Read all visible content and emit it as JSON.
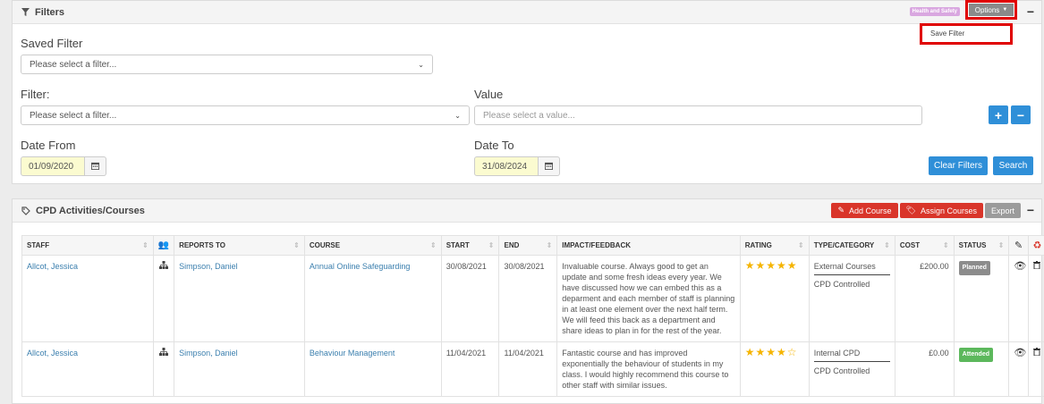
{
  "filters": {
    "title": "Filters",
    "tag": "Health and Safety",
    "options_label": "Options",
    "dropdown": {
      "save_filter": "Save Filter"
    },
    "saved_filter": {
      "label": "Saved Filter",
      "value": "Please select a filter..."
    },
    "filter": {
      "label": "Filter:",
      "value": "Please select a filter..."
    },
    "value": {
      "label": "Value",
      "placeholder": "Please select a value..."
    },
    "date_from": {
      "label": "Date From",
      "value": "01/09/2020"
    },
    "date_to": {
      "label": "Date To",
      "value": "31/08/2024"
    },
    "add_label": "+",
    "remove_label": "−",
    "clear_label": "Clear Filters",
    "search_label": "Search"
  },
  "cpd": {
    "title": "CPD Activities/Courses",
    "add_course": "Add Course",
    "assign_courses": "Assign Courses",
    "export": "Export",
    "columns": {
      "staff": "STAFF",
      "reports_to": "REPORTS TO",
      "course": "COURSE",
      "start": "START",
      "end": "END",
      "impact": "IMPACT/FEEDBACK",
      "rating": "RATING",
      "type": "TYPE/CATEGORY",
      "cost": "COST",
      "status": "STATUS"
    },
    "rows": [
      {
        "staff": "Allcot, Jessica",
        "reports_to": "Simpson, Daniel",
        "course": "Annual Online Safeguarding",
        "start": "30/08/2021",
        "end": "30/08/2021",
        "impact": "Invaluable course. Always good to get an update and some fresh ideas every year. We have discussed how we can embed this as a deparment and each member of staff is planning in at least one element over the next half term. We will feed this back as a department and share ideas to plan in for the rest of the year.",
        "rating": 5,
        "rating_stars": "★★★★★",
        "type": "External Courses",
        "category": "CPD Controlled",
        "cost": "£200.00",
        "status": "Planned",
        "status_color": "#8c8c8c"
      },
      {
        "staff": "Allcot, Jessica",
        "reports_to": "Simpson, Daniel",
        "course": "Behaviour Management",
        "start": "11/04/2021",
        "end": "11/04/2021",
        "impact": "Fantastic course and has improved exponentially the behaviour of students in my class. I would highly recommend this course to other staff with similar issues.",
        "rating": 4,
        "rating_stars": "★★★★☆",
        "type": "Internal CPD",
        "category": "CPD Controlled",
        "cost": "£0.00",
        "status": "Attended",
        "status_color": "#5cb85c"
      }
    ]
  },
  "colors": {
    "accent": "#2f8fd8",
    "danger": "#d9352a",
    "highlight": "#e00000"
  }
}
